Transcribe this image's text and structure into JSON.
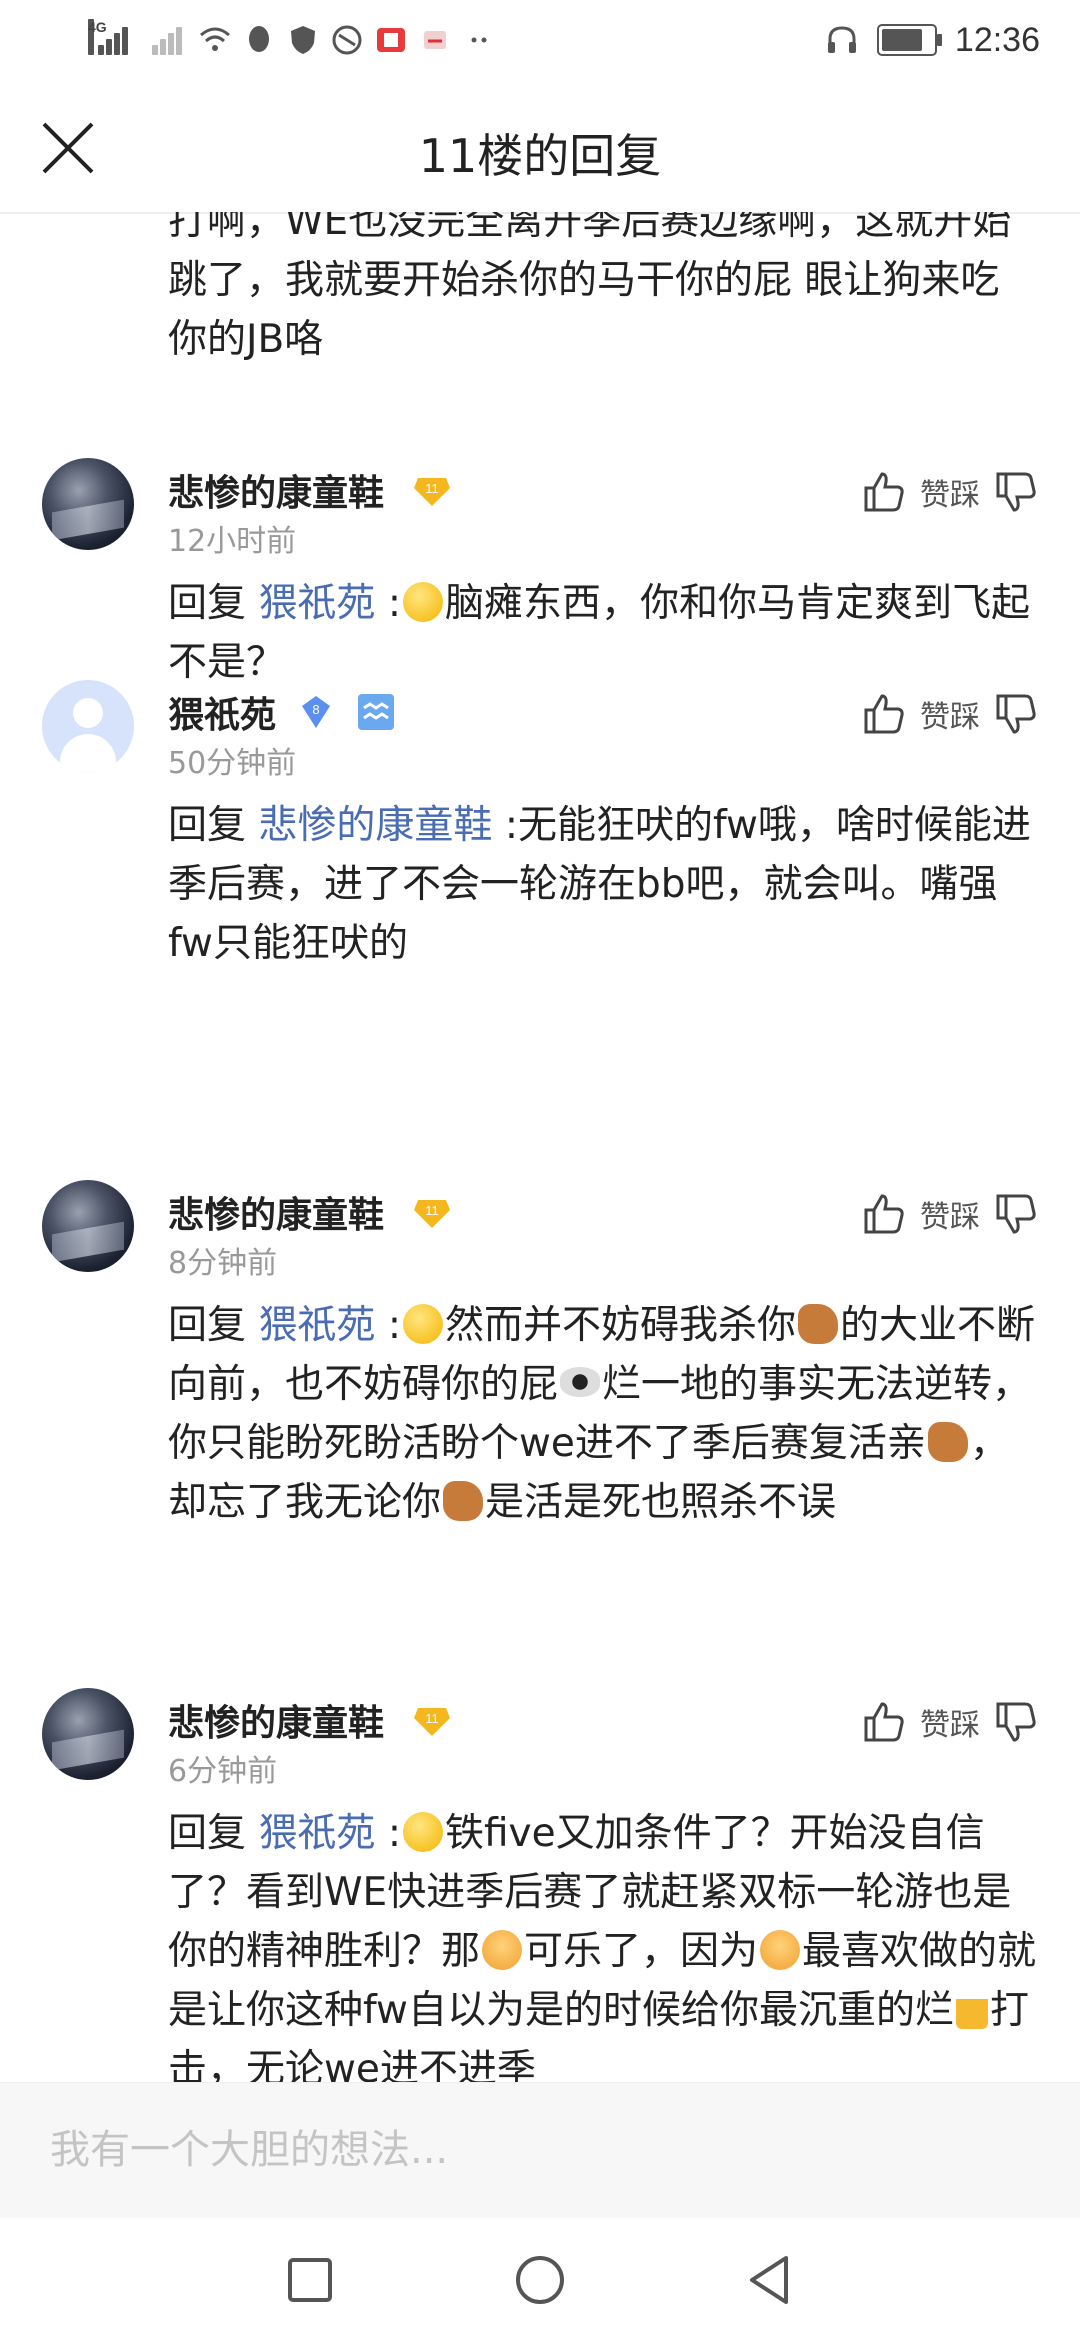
{
  "status_bar": {
    "network": "4G",
    "time": "12:36",
    "icons": [
      "signal-icon",
      "wifi-icon",
      "qq-icon",
      "shield-icon",
      "browser-icon",
      "reader-icon",
      "app-icon",
      "more-dots-icon",
      "headphones-icon",
      "battery-icon"
    ]
  },
  "header": {
    "title": "11楼的回复",
    "close_icon": "close-icon"
  },
  "previous_text": "打啊，WE也没完全离开季后赛边缘啊，这就开始跳了，我就要开始杀你的马干你的屁 眼让狗来吃你的JB咯",
  "replies": [
    {
      "username": "悲惨的康童鞋",
      "level": "11",
      "time": "12小时前",
      "prefix": "回复 ",
      "mention": "猥祇苑",
      "colon": " :",
      "segments": [
        "脑瘫东西，你和你马肯定爽到飞起不是？"
      ]
    },
    {
      "username": "猥祇苑",
      "level": "8",
      "time": "50分钟前",
      "prefix": "回复 ",
      "mention": "悲惨的康童鞋",
      "colon": " :",
      "segments": [
        "无能狂吠的fw哦，啥时候能进季后赛，进了不会一轮游在bb吧，就会叫。嘴强fw只能狂吠的"
      ]
    },
    {
      "username": "悲惨的康童鞋",
      "level": "11",
      "time": "8分钟前",
      "prefix": "回复 ",
      "mention": "猥祇苑",
      "colon": " :",
      "segments": [
        "然而并不妨碍我杀你",
        "的大业不断向前，也不妨碍你的屁",
        "烂一地的事实无法逆转，你只能盼死盼活盼个we进不了季后赛复活亲",
        "，却忘了我无论你",
        "是活是死也照杀不误"
      ]
    },
    {
      "username": "悲惨的康童鞋",
      "level": "11",
      "time": "6分钟前",
      "prefix": "回复 ",
      "mention": "猥祇苑",
      "colon": " :",
      "segments": [
        "铁five又加条件了？开始没自信了？看到WE快进季后赛了就赶紧双标一轮游也是你的精神胜利？那",
        "可乐了，因为",
        "最喜欢做的就是让你这种fw自以为是的时候给你最沉重的烂",
        "打击，无论we进不进季"
      ]
    }
  ],
  "actions": {
    "like_dislike_label": "赞踩"
  },
  "input": {
    "placeholder": "我有一个大胆的想法..."
  },
  "nav": [
    "recents-button",
    "home-button",
    "back-button"
  ]
}
